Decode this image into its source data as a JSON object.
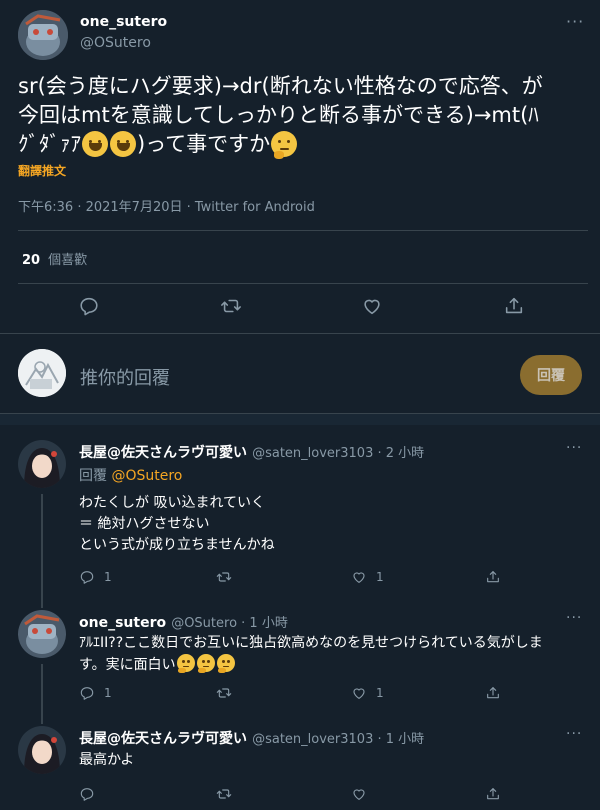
{
  "main_tweet": {
    "name": "one_sutero",
    "handle": "@OSutero",
    "text_line1": "sr(会う度にハグ要求)→dr(断れない性格なので応答、が",
    "text_line2": "今回はmtを意識してしっかりと断る事ができる)→mt(ﾊ",
    "text_line3_a": "ｸﾞﾀﾞｧｱ",
    "text_line3_b": ")って事ですか",
    "translate": "翻譯推文",
    "meta": "下午6:36 · 2021年7月20日 · Twitter for Android",
    "likes_count": "20",
    "likes_label": "個喜歡",
    "more_icon": "more-icon"
  },
  "composer": {
    "placeholder": "推你的回覆",
    "button": "回覆"
  },
  "replies": [
    {
      "name": "長屋@佐天さんラヴ可愛い",
      "handle": "@saten_lover3103 · 2 小時",
      "reply_prefix": "回覆",
      "reply_to": "@OSutero",
      "line1": "わたくしが 吸い込まれていく",
      "line2": "＝ 絶対ハグさせない",
      "line3": "という式が成り立ちませんかね",
      "reply_count": "1",
      "like_count": "1"
    },
    {
      "name": "one_sutero",
      "handle": "@OSutero · 1 小時",
      "line1": "ｱﾙｴII??ここ数日でお互いに独占欲高めなのを見せつけられている気がしま",
      "line2": "す。実に面白い",
      "reply_count": "1",
      "like_count": "1"
    },
    {
      "name": "長屋@佐天さんラヴ可愛い",
      "handle": "@saten_lover3103 · 1 小時",
      "line1": "最高かよ"
    }
  ],
  "colors": {
    "background": "#15202b",
    "accent": "#f5a623",
    "muted": "#8899a6",
    "divider": "#38444d"
  }
}
